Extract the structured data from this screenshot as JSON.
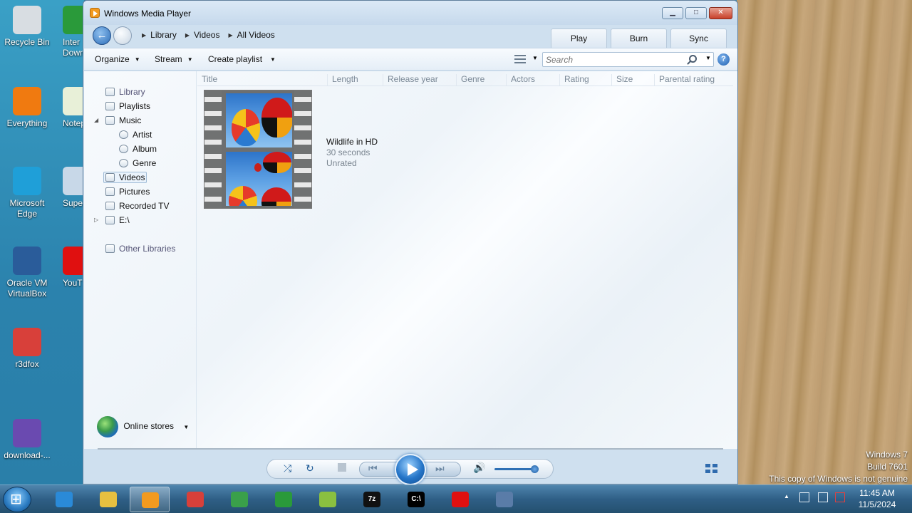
{
  "desktop": {
    "icons": [
      {
        "label": "Recycle Bin",
        "icon": "recycle-bin-icon",
        "color": "#d8dde2"
      },
      {
        "label": "Everything",
        "icon": "everything-icon",
        "color": "#f07a10"
      },
      {
        "label": "Microsoft Edge",
        "icon": "edge-icon",
        "color": "#1f9fd8"
      },
      {
        "label": "Oracle VM VirtualBox",
        "icon": "virtualbox-icon",
        "color": "#2a5c9a"
      },
      {
        "label": "r3dfox",
        "icon": "r3dfox-icon",
        "color": "#d8403a"
      },
      {
        "label": "download-...",
        "icon": "download-icon",
        "color": "#6a4ab0"
      }
    ],
    "partial_icons": [
      {
        "label": "Inter Down",
        "icon": "idm-icon",
        "color": "#2a9a3a"
      },
      {
        "label": "Notep",
        "icon": "notepad-icon",
        "color": "#e8f0d8"
      },
      {
        "label": "Super",
        "icon": "super-icon",
        "color": "#c8d8e8"
      },
      {
        "label": "YouT",
        "icon": "youtube-icon",
        "color": "#e01010"
      }
    ],
    "watermark": {
      "line1": "Windows 7",
      "line2": "Build 7601",
      "line3": "This copy of Windows is not genuine"
    }
  },
  "window": {
    "title": "Windows Media Player",
    "controls": {
      "minimize": "▁",
      "maximize": "□",
      "close": "✕"
    }
  },
  "navbar": {
    "breadcrumb": [
      "Library",
      "Videos",
      "All Videos"
    ],
    "tabs": [
      "Play",
      "Burn",
      "Sync"
    ]
  },
  "toolbar": {
    "organize": "Organize",
    "stream": "Stream",
    "create_playlist": "Create playlist",
    "search_placeholder": "Search"
  },
  "navpane": {
    "items": [
      {
        "label": "Library",
        "icon": "library-icon",
        "level": 0,
        "dim": true
      },
      {
        "label": "Playlists",
        "icon": "playlist-icon",
        "level": 0
      },
      {
        "label": "Music",
        "icon": "music-icon",
        "level": 0,
        "expanded": true
      },
      {
        "label": "Artist",
        "icon": "artist-icon",
        "level": 1
      },
      {
        "label": "Album",
        "icon": "album-icon",
        "level": 1
      },
      {
        "label": "Genre",
        "icon": "genre-icon",
        "level": 1
      },
      {
        "label": "Videos",
        "icon": "videos-icon",
        "level": 0,
        "selected": true
      },
      {
        "label": "Pictures",
        "icon": "pictures-icon",
        "level": 0
      },
      {
        "label": "Recorded TV",
        "icon": "recorded-tv-icon",
        "level": 0
      },
      {
        "label": "E:\\",
        "icon": "drive-icon",
        "level": 0,
        "collapsed": true
      },
      {
        "label": "Other Libraries",
        "icon": "other-libraries-icon",
        "level": 0,
        "dim": true
      }
    ],
    "online_stores": "Online stores"
  },
  "columns": [
    "Title",
    "Length",
    "Release year",
    "Genre",
    "Actors",
    "Rating",
    "Size",
    "Parental rating"
  ],
  "videos": [
    {
      "title": "Wildlife in HD",
      "length": "30 seconds",
      "rating": "Unrated"
    }
  ],
  "player": {
    "volume_fraction": 0.9
  },
  "taskbar": {
    "apps": [
      {
        "icon": "internet-explorer-icon",
        "color": "#2a8ad8"
      },
      {
        "icon": "file-explorer-icon",
        "color": "#e8c040"
      },
      {
        "icon": "windows-media-player-icon",
        "color": "#f29a20",
        "active": true
      },
      {
        "icon": "r3dfox-icon",
        "color": "#d8403a"
      },
      {
        "icon": "chrome-icon",
        "color": "#3aa04a"
      },
      {
        "icon": "idm-icon",
        "color": "#2a9a3a"
      },
      {
        "icon": "notepad-plus-icon",
        "color": "#8ac040"
      },
      {
        "icon": "7zip-icon",
        "color": "#111111",
        "label": "7z"
      },
      {
        "icon": "cmd-icon",
        "color": "#000000",
        "label": "C:\\"
      },
      {
        "icon": "youtube-icon",
        "color": "#e01010"
      },
      {
        "icon": "virtualbox-icon",
        "color": "#5a7ca8"
      }
    ],
    "time": "11:45 AM",
    "date": "11/5/2024"
  }
}
